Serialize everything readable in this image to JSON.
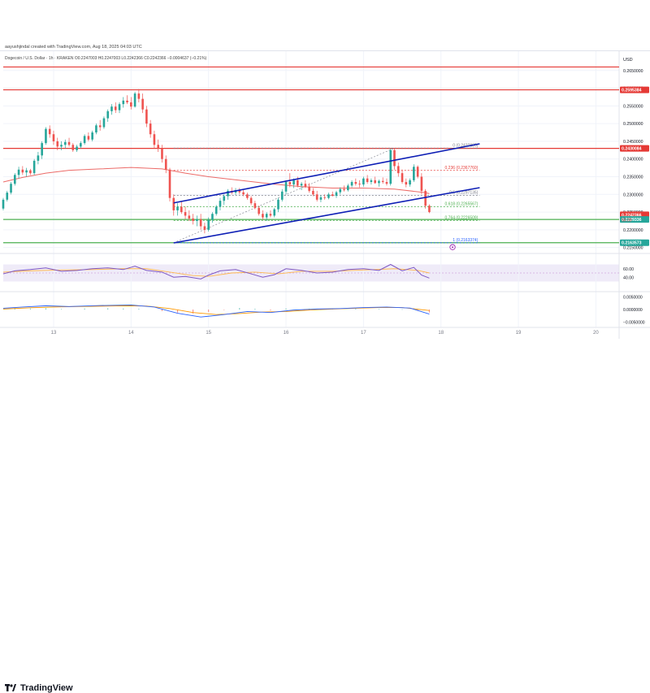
{
  "created_line": "aayushjindal created with TradingView.com, Aug 18, 2025 04:03 UTC",
  "symbol_line": "Dogecoin / U.S. Dollar · 1h · KRAKEN  O0.2247003 H0.2247003 L0.2242366 C0.2242366 −0.0004637 (−0.21%)",
  "logo": {
    "text": "TradingView",
    "icon": "tradingview-logo-icon"
  },
  "chart_data": {
    "type": "candlestick",
    "currency": "USD",
    "y_ticks": [
      "0.2650000",
      "0.2600000",
      "0.2550000",
      "0.2500000",
      "0.2450000",
      "0.2400000",
      "0.2350000",
      "0.2300000",
      "0.2250000",
      "0.2200000",
      "0.2150000"
    ],
    "x_labels": [
      "13",
      "14",
      "15",
      "16",
      "17",
      "18",
      "19",
      "20"
    ],
    "price_tags": [
      {
        "value": "0.2595384",
        "color": "#e53935"
      },
      {
        "value": "0.2430084",
        "color": "#e53935"
      },
      {
        "value": "0.2242366",
        "color": "#e53935"
      },
      {
        "value": "0.2229336",
        "color": "#26a69a"
      },
      {
        "value": "0.2163573",
        "color": "#26a69a"
      }
    ],
    "countdown": "56:39",
    "horizontal_levels": [
      {
        "price": 0.266,
        "color": "#e53935",
        "tag": false
      },
      {
        "price": 0.25954,
        "color": "#e53935",
        "tag": true
      },
      {
        "price": 0.24301,
        "color": "#e53935",
        "tag": true
      },
      {
        "price": 0.22293,
        "color": "#4caf50",
        "tag": true
      },
      {
        "price": 0.21636,
        "color": "#4caf50",
        "tag": true
      }
    ],
    "fibonacci": [
      {
        "ratio": "0",
        "value": "0.2430895",
        "color": "#787b86"
      },
      {
        "ratio": "0.236",
        "value": "0.2367760",
        "color": "#e53935"
      },
      {
        "ratio": "0.5",
        "value": "0.2297135",
        "color": "#787b86"
      },
      {
        "ratio": "0.618",
        "value": "0.2265567",
        "color": "#4caf50"
      },
      {
        "ratio": "0.764",
        "value": "0.2226509",
        "color": "#4caf50"
      },
      {
        "ratio": "1",
        "value": "0.2163374",
        "color": "#2962ff"
      }
    ],
    "channel": [
      {
        "x1": 14.55,
        "y1": 0.2163,
        "x2": 18.5,
        "y2": 0.2319,
        "color": "#0d1eb5"
      },
      {
        "x1": 14.55,
        "y1": 0.2276,
        "x2": 18.5,
        "y2": 0.2443,
        "color": "#0d1eb5"
      }
    ],
    "candles": [
      [
        12.35,
        0.226,
        0.229,
        0.2255,
        0.2285
      ],
      [
        12.4,
        0.2285,
        0.231,
        0.228,
        0.2305
      ],
      [
        12.45,
        0.2305,
        0.2335,
        0.23,
        0.233
      ],
      [
        12.5,
        0.233,
        0.236,
        0.2325,
        0.2355
      ],
      [
        12.55,
        0.2355,
        0.2378,
        0.2345,
        0.237
      ],
      [
        12.6,
        0.237,
        0.238,
        0.2355,
        0.2362
      ],
      [
        12.65,
        0.2362,
        0.2375,
        0.235,
        0.2368
      ],
      [
        12.7,
        0.2368,
        0.2372,
        0.2355,
        0.236
      ],
      [
        12.75,
        0.236,
        0.24,
        0.2355,
        0.2395
      ],
      [
        12.8,
        0.2395,
        0.242,
        0.2385,
        0.241
      ],
      [
        12.85,
        0.241,
        0.245,
        0.24,
        0.2445
      ],
      [
        12.9,
        0.2445,
        0.249,
        0.244,
        0.2485
      ],
      [
        12.95,
        0.2485,
        0.2495,
        0.246,
        0.247
      ],
      [
        13.0,
        0.247,
        0.248,
        0.244,
        0.245
      ],
      [
        13.05,
        0.245,
        0.246,
        0.2425,
        0.2435
      ],
      [
        13.1,
        0.2435,
        0.245,
        0.2425,
        0.244
      ],
      [
        13.15,
        0.244,
        0.2455,
        0.243,
        0.2448
      ],
      [
        13.2,
        0.2448,
        0.246,
        0.2435,
        0.244
      ],
      [
        13.25,
        0.244,
        0.2445,
        0.242,
        0.2425
      ],
      [
        13.3,
        0.2425,
        0.244,
        0.242,
        0.2435
      ],
      [
        13.35,
        0.2435,
        0.245,
        0.243,
        0.2445
      ],
      [
        13.4,
        0.2445,
        0.247,
        0.244,
        0.2465
      ],
      [
        13.45,
        0.2465,
        0.2475,
        0.245,
        0.2455
      ],
      [
        13.5,
        0.2455,
        0.248,
        0.245,
        0.2475
      ],
      [
        13.55,
        0.2475,
        0.25,
        0.247,
        0.2495
      ],
      [
        13.6,
        0.2495,
        0.251,
        0.248,
        0.249
      ],
      [
        13.65,
        0.249,
        0.252,
        0.2485,
        0.2515
      ],
      [
        13.7,
        0.2515,
        0.254,
        0.2505,
        0.2535
      ],
      [
        13.75,
        0.2535,
        0.2555,
        0.2525,
        0.2548
      ],
      [
        13.8,
        0.2548,
        0.256,
        0.253,
        0.2538
      ],
      [
        13.85,
        0.2538,
        0.256,
        0.253,
        0.2555
      ],
      [
        13.9,
        0.2555,
        0.2575,
        0.2545,
        0.2565
      ],
      [
        13.95,
        0.2565,
        0.258,
        0.2555,
        0.256
      ],
      [
        14.0,
        0.256,
        0.2575,
        0.254,
        0.2548
      ],
      [
        14.05,
        0.2548,
        0.259,
        0.2545,
        0.2585
      ],
      [
        14.1,
        0.2585,
        0.2598,
        0.256,
        0.257
      ],
      [
        14.15,
        0.257,
        0.2585,
        0.253,
        0.254
      ],
      [
        14.2,
        0.254,
        0.255,
        0.249,
        0.25
      ],
      [
        14.25,
        0.25,
        0.251,
        0.246,
        0.247
      ],
      [
        14.3,
        0.247,
        0.248,
        0.243,
        0.244
      ],
      [
        14.35,
        0.244,
        0.2455,
        0.242,
        0.243
      ],
      [
        14.4,
        0.243,
        0.244,
        0.239,
        0.24
      ],
      [
        14.45,
        0.24,
        0.241,
        0.236,
        0.237
      ],
      [
        14.5,
        0.237,
        0.2375,
        0.228,
        0.229
      ],
      [
        14.55,
        0.229,
        0.23,
        0.224,
        0.2255
      ],
      [
        14.6,
        0.2255,
        0.2275,
        0.224,
        0.2265
      ],
      [
        14.65,
        0.2265,
        0.228,
        0.2245,
        0.225
      ],
      [
        14.7,
        0.225,
        0.2265,
        0.223,
        0.224
      ],
      [
        14.75,
        0.224,
        0.2255,
        0.2225,
        0.2232
      ],
      [
        14.8,
        0.2232,
        0.2245,
        0.2215,
        0.2225
      ],
      [
        14.85,
        0.2225,
        0.224,
        0.221,
        0.223
      ],
      [
        14.9,
        0.223,
        0.2245,
        0.22,
        0.221
      ],
      [
        14.95,
        0.221,
        0.222,
        0.219,
        0.22
      ],
      [
        15.0,
        0.22,
        0.2235,
        0.2195,
        0.2228
      ],
      [
        15.05,
        0.2228,
        0.225,
        0.222,
        0.2245
      ],
      [
        15.1,
        0.2245,
        0.227,
        0.224,
        0.2265
      ],
      [
        15.15,
        0.2265,
        0.229,
        0.2255,
        0.2282
      ],
      [
        15.2,
        0.2282,
        0.23,
        0.227,
        0.2295
      ],
      [
        15.25,
        0.2295,
        0.2315,
        0.2285,
        0.231
      ],
      [
        15.3,
        0.231,
        0.232,
        0.23,
        0.2305
      ],
      [
        15.35,
        0.2305,
        0.2318,
        0.2298,
        0.2312
      ],
      [
        15.4,
        0.2312,
        0.2318,
        0.23,
        0.2306
      ],
      [
        15.45,
        0.2306,
        0.2312,
        0.2295,
        0.23
      ],
      [
        15.5,
        0.23,
        0.2305,
        0.2285,
        0.229
      ],
      [
        15.55,
        0.229,
        0.2295,
        0.227,
        0.2275
      ],
      [
        15.6,
        0.2275,
        0.2282,
        0.2258,
        0.2262
      ],
      [
        15.65,
        0.2262,
        0.2268,
        0.224,
        0.2245
      ],
      [
        15.7,
        0.2245,
        0.2255,
        0.2228,
        0.2235
      ],
      [
        15.75,
        0.2235,
        0.225,
        0.2225,
        0.2245
      ],
      [
        15.8,
        0.2245,
        0.2255,
        0.2235,
        0.224
      ],
      [
        15.85,
        0.224,
        0.2262,
        0.2235,
        0.2258
      ],
      [
        15.9,
        0.2258,
        0.229,
        0.225,
        0.2285
      ],
      [
        15.95,
        0.2285,
        0.2315,
        0.228,
        0.2308
      ],
      [
        16.0,
        0.2308,
        0.234,
        0.23,
        0.2335
      ],
      [
        16.05,
        0.2335,
        0.236,
        0.232,
        0.2328
      ],
      [
        16.1,
        0.2328,
        0.2345,
        0.2318,
        0.234
      ],
      [
        16.15,
        0.234,
        0.235,
        0.232,
        0.2325
      ],
      [
        16.2,
        0.2325,
        0.2335,
        0.2312,
        0.233
      ],
      [
        16.25,
        0.233,
        0.234,
        0.2318,
        0.2322
      ],
      [
        16.3,
        0.2322,
        0.2332,
        0.2305,
        0.231
      ],
      [
        16.35,
        0.231,
        0.2318,
        0.2295,
        0.23
      ],
      [
        16.4,
        0.23,
        0.231,
        0.228,
        0.2285
      ],
      [
        16.45,
        0.2285,
        0.2298,
        0.2278,
        0.2292
      ],
      [
        16.5,
        0.2292,
        0.23,
        0.2285,
        0.229
      ],
      [
        16.55,
        0.229,
        0.2305,
        0.2286,
        0.23
      ],
      [
        16.6,
        0.23,
        0.2308,
        0.2294,
        0.2296
      ],
      [
        16.65,
        0.2296,
        0.231,
        0.229,
        0.2306
      ],
      [
        16.7,
        0.2306,
        0.232,
        0.23,
        0.2315
      ],
      [
        16.75,
        0.2315,
        0.2325,
        0.2308,
        0.2312
      ],
      [
        16.8,
        0.2312,
        0.233,
        0.2308,
        0.2325
      ],
      [
        16.85,
        0.2325,
        0.234,
        0.232,
        0.2335
      ],
      [
        16.9,
        0.2335,
        0.2345,
        0.2325,
        0.233
      ],
      [
        16.95,
        0.233,
        0.234,
        0.232,
        0.2328
      ],
      [
        17.0,
        0.2328,
        0.235,
        0.2322,
        0.2345
      ],
      [
        17.05,
        0.2345,
        0.2355,
        0.233,
        0.2335
      ],
      [
        17.1,
        0.2335,
        0.2345,
        0.2328,
        0.234
      ],
      [
        17.15,
        0.234,
        0.235,
        0.233,
        0.2332
      ],
      [
        17.2,
        0.2332,
        0.2342,
        0.2322,
        0.2338
      ],
      [
        17.25,
        0.2338,
        0.2348,
        0.233,
        0.2335
      ],
      [
        17.3,
        0.2335,
        0.2345,
        0.2325,
        0.233
      ],
      [
        17.35,
        0.233,
        0.243,
        0.2325,
        0.2425
      ],
      [
        17.4,
        0.2425,
        0.2431,
        0.237,
        0.238
      ],
      [
        17.45,
        0.238,
        0.239,
        0.235,
        0.236
      ],
      [
        17.5,
        0.236,
        0.237,
        0.233,
        0.2335
      ],
      [
        17.55,
        0.2335,
        0.2345,
        0.232,
        0.2328
      ],
      [
        17.6,
        0.2328,
        0.2345,
        0.2322,
        0.234
      ],
      [
        17.65,
        0.234,
        0.2385,
        0.2335,
        0.2378
      ],
      [
        17.7,
        0.2378,
        0.2382,
        0.2345,
        0.235
      ],
      [
        17.75,
        0.235,
        0.236,
        0.23,
        0.231
      ],
      [
        17.8,
        0.231,
        0.2315,
        0.226,
        0.2268
      ],
      [
        17.85,
        0.2268,
        0.2272,
        0.2247,
        0.225
      ]
    ],
    "ma_points": [
      [
        12.35,
        0.2335
      ],
      [
        12.6,
        0.2348
      ],
      [
        12.9,
        0.236
      ],
      [
        13.2,
        0.2368
      ],
      [
        13.6,
        0.2372
      ],
      [
        14.0,
        0.2376
      ],
      [
        14.4,
        0.2372
      ],
      [
        14.7,
        0.236
      ],
      [
        15.0,
        0.235
      ],
      [
        15.4,
        0.234
      ],
      [
        15.8,
        0.233
      ],
      [
        16.2,
        0.2322
      ],
      [
        16.6,
        0.2318
      ],
      [
        17.0,
        0.2318
      ],
      [
        17.4,
        0.2315
      ],
      [
        17.8,
        0.2305
      ],
      [
        17.85,
        0.2302
      ]
    ],
    "rsi": {
      "ticks": [
        "60.00",
        "40.00"
      ],
      "line": [
        [
          12.35,
          48
        ],
        [
          12.5,
          55
        ],
        [
          12.7,
          58
        ],
        [
          12.9,
          62
        ],
        [
          13.1,
          54
        ],
        [
          13.3,
          56
        ],
        [
          13.5,
          60
        ],
        [
          13.7,
          62
        ],
        [
          13.9,
          58
        ],
        [
          14.05,
          66
        ],
        [
          14.2,
          56
        ],
        [
          14.4,
          52
        ],
        [
          14.55,
          40
        ],
        [
          14.7,
          42
        ],
        [
          14.9,
          36
        ],
        [
          15.0,
          45
        ],
        [
          15.15,
          55
        ],
        [
          15.35,
          58
        ],
        [
          15.55,
          48
        ],
        [
          15.7,
          40
        ],
        [
          15.85,
          46
        ],
        [
          16.0,
          60
        ],
        [
          16.2,
          56
        ],
        [
          16.4,
          50
        ],
        [
          16.6,
          52
        ],
        [
          16.8,
          58
        ],
        [
          17.0,
          60
        ],
        [
          17.2,
          56
        ],
        [
          17.35,
          70
        ],
        [
          17.5,
          55
        ],
        [
          17.65,
          63
        ],
        [
          17.75,
          45
        ],
        [
          17.85,
          38
        ]
      ],
      "signal": [
        [
          12.35,
          52
        ],
        [
          12.7,
          55
        ],
        [
          13.1,
          57
        ],
        [
          13.5,
          58
        ],
        [
          13.9,
          60
        ],
        [
          14.2,
          60
        ],
        [
          14.5,
          52
        ],
        [
          14.8,
          44
        ],
        [
          15.0,
          42
        ],
        [
          15.3,
          50
        ],
        [
          15.6,
          52
        ],
        [
          15.9,
          48
        ],
        [
          16.2,
          54
        ],
        [
          16.6,
          54
        ],
        [
          17.0,
          57
        ],
        [
          17.4,
          60
        ],
        [
          17.7,
          56
        ],
        [
          17.85,
          50
        ]
      ]
    },
    "macd": {
      "ticks": [
        "0.0050000",
        "0.0000000",
        "−0.0050000"
      ],
      "macd_line": [
        [
          12.35,
          0.0005
        ],
        [
          12.6,
          0.001
        ],
        [
          12.9,
          0.0015
        ],
        [
          13.2,
          0.0012
        ],
        [
          13.6,
          0.0016
        ],
        [
          14.0,
          0.0018
        ],
        [
          14.3,
          0.001
        ],
        [
          14.6,
          -0.0015
        ],
        [
          14.9,
          -0.003
        ],
        [
          15.2,
          -0.002
        ],
        [
          15.5,
          -0.0008
        ],
        [
          15.8,
          -0.0012
        ],
        [
          16.1,
          -0.0002
        ],
        [
          16.4,
          0.0002
        ],
        [
          16.7,
          0.0004
        ],
        [
          17.0,
          0.0008
        ],
        [
          17.3,
          0.001
        ],
        [
          17.6,
          0.0006
        ],
        [
          17.85,
          -0.0018
        ]
      ],
      "signal_line": [
        [
          12.35,
          0.0002
        ],
        [
          12.7,
          0.0007
        ],
        [
          13.1,
          0.0011
        ],
        [
          13.5,
          0.0013
        ],
        [
          13.9,
          0.0015
        ],
        [
          14.2,
          0.0014
        ],
        [
          14.5,
          0.0004
        ],
        [
          14.8,
          -0.0012
        ],
        [
          15.1,
          -0.002
        ],
        [
          15.4,
          -0.0016
        ],
        [
          15.7,
          -0.001
        ],
        [
          16.0,
          -0.0008
        ],
        [
          16.3,
          -0.0002
        ],
        [
          16.6,
          0.0002
        ],
        [
          16.9,
          0.0005
        ],
        [
          17.2,
          0.0008
        ],
        [
          17.5,
          0.0008
        ],
        [
          17.85,
          -0.0004
        ]
      ],
      "hist": [
        [
          12.5,
          0.0006
        ],
        [
          12.7,
          0.0004
        ],
        [
          12.9,
          0.0005
        ],
        [
          13.1,
          0.0002
        ],
        [
          13.4,
          0.0004
        ],
        [
          13.7,
          0.0005
        ],
        [
          13.9,
          0.0004
        ],
        [
          14.1,
          0.0003
        ],
        [
          14.4,
          -0.0006
        ],
        [
          14.6,
          -0.0012
        ],
        [
          14.8,
          -0.0016
        ],
        [
          15.0,
          -0.001
        ],
        [
          15.2,
          -0.0002
        ],
        [
          15.4,
          0.0006
        ],
        [
          15.6,
          0.0003
        ],
        [
          15.8,
          -0.0004
        ],
        [
          16.0,
          0.0004
        ],
        [
          16.3,
          0.0003
        ],
        [
          16.6,
          0.0002
        ],
        [
          16.9,
          0.0003
        ],
        [
          17.2,
          0.0002
        ],
        [
          17.5,
          0.0001
        ],
        [
          17.7,
          -0.0006
        ],
        [
          17.85,
          -0.0012
        ]
      ]
    }
  }
}
